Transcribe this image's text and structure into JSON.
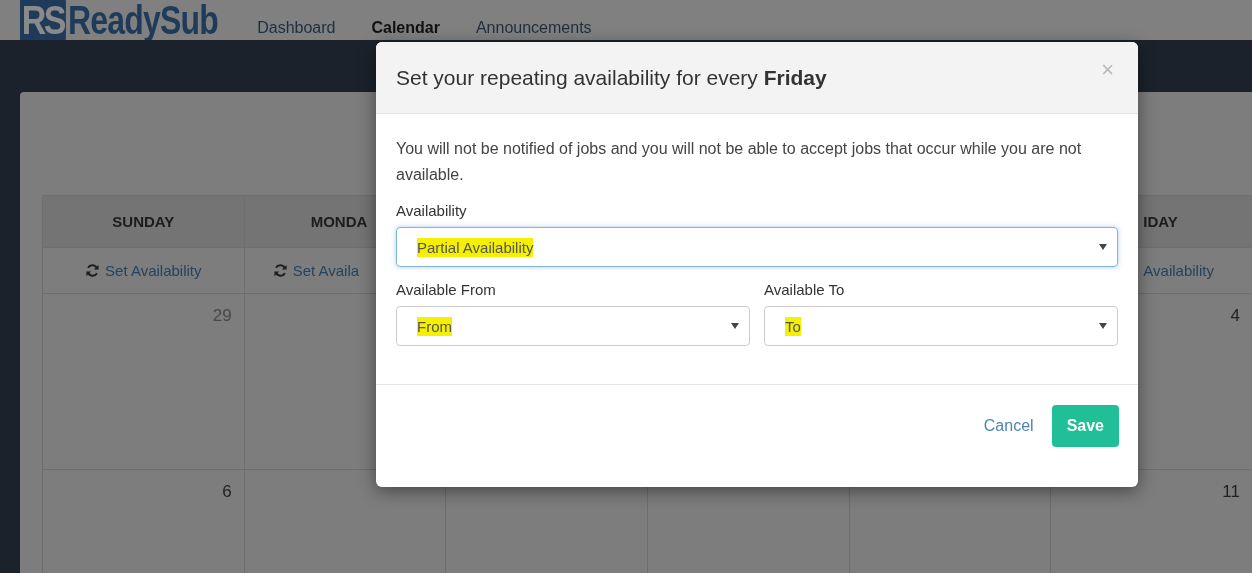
{
  "nav": {
    "logo_mark": "RS",
    "logo_text": "ReadySub",
    "links": [
      {
        "label": "Dashboard",
        "selected": false
      },
      {
        "label": "Calendar",
        "selected": true
      },
      {
        "label": "Announcements",
        "selected": false
      }
    ]
  },
  "calendar": {
    "left_columns": [
      {
        "header": "SUNDAY",
        "link": "Set Availability",
        "dates": [
          {
            "text": "29",
            "other_month": true
          },
          {
            "text": "6",
            "other_month": false
          }
        ]
      },
      {
        "header": "MONDA",
        "link": "Set Availa"
      }
    ],
    "right_columns": [
      {
        "header": "IDAY",
        "link": "Availability",
        "dates": [
          {
            "text": "4",
            "other_month": false
          },
          {
            "text": "11",
            "other_month": false
          }
        ]
      }
    ]
  },
  "modal": {
    "title": "Set your repeating availability for every **Friday**",
    "close": "×",
    "message": "You will not be notified of jobs and you will not be able to accept jobs that occur while you are not available.",
    "fields": [
      {
        "label": "Availability",
        "value": "Partial Availability",
        "highlighted": true,
        "focused": true
      },
      {
        "label": "Available From",
        "value": "From",
        "highlighted": true,
        "focused": false
      },
      {
        "label": "Available To",
        "value": "To",
        "highlighted": true,
        "focused": false
      }
    ],
    "buttons": [
      {
        "label": "Cancel",
        "kind": "link"
      },
      {
        "label": "Save",
        "kind": "primary"
      }
    ]
  }
}
